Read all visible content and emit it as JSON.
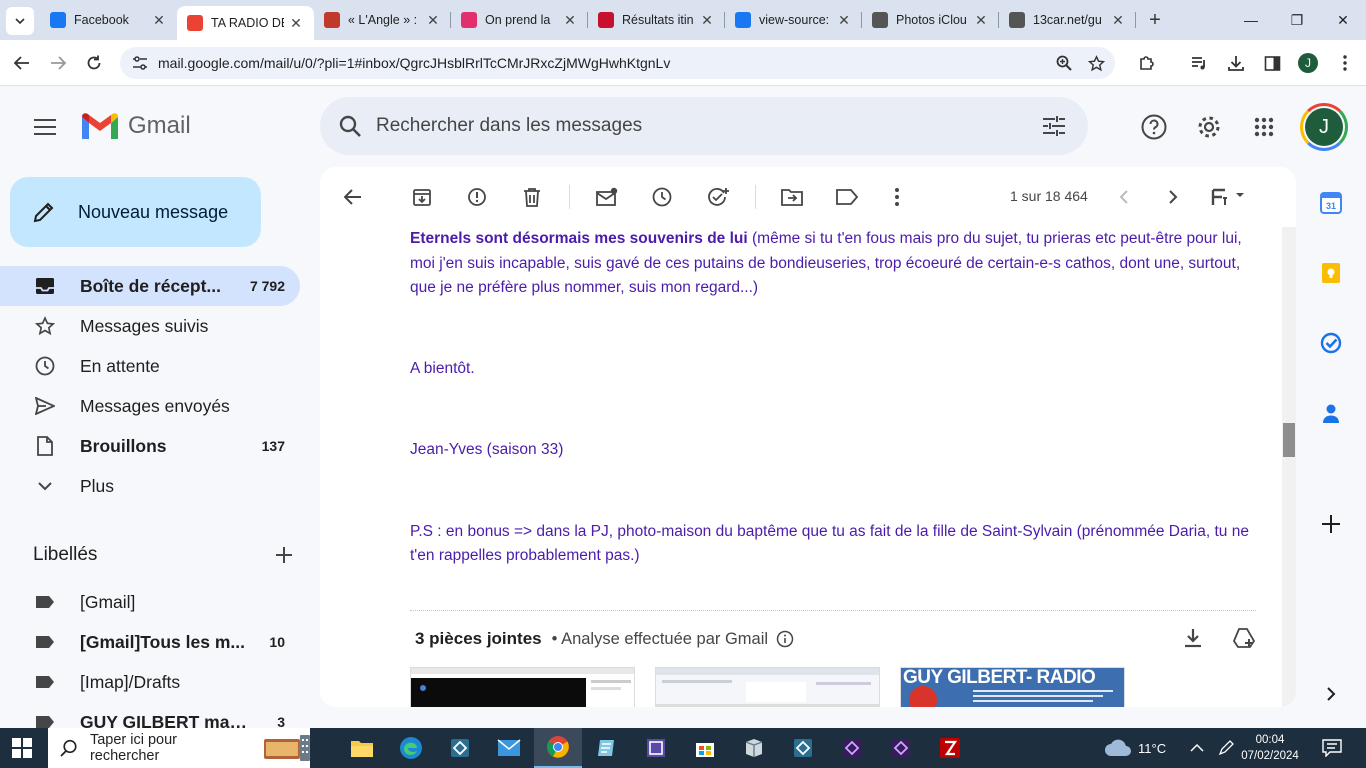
{
  "browser": {
    "tabs": [
      {
        "title": "Facebook",
        "favicon": "facebook-icon",
        "color": "#1877f2"
      },
      {
        "title": "TA RADIO DE",
        "favicon": "gmail-icon",
        "color": "#ea4335",
        "active": true
      },
      {
        "title": "« L'Angle » :",
        "favicon": "site-icon",
        "color": "#c0392b"
      },
      {
        "title": "On prend la",
        "favicon": "instagram-icon",
        "color": "#e1306c"
      },
      {
        "title": "Résultats itin",
        "favicon": "sncf-icon",
        "color": "#c8102e"
      },
      {
        "title": "view-source:",
        "favicon": "facebook-icon",
        "color": "#1877f2"
      },
      {
        "title": "Photos iClou",
        "favicon": "apple-icon",
        "color": "#555555"
      },
      {
        "title": "13car.net/gu",
        "favicon": "globe-icon",
        "color": "#555555"
      }
    ],
    "url": "mail.google.com/mail/u/0/?pli=1#inbox/QgrcJHsblRrlTcCMrJRxcZjMWgHwhKtgnLv",
    "profile_initial": "J"
  },
  "gmail": {
    "app_name": "Gmail",
    "search_placeholder": "Rechercher dans les messages",
    "account_initial": "J",
    "compose_label": "Nouveau message",
    "nav": [
      {
        "label": "Boîte de récept...",
        "count": "7 792",
        "icon": "inbox-icon",
        "active": true,
        "bold": true
      },
      {
        "label": "Messages suivis",
        "count": "",
        "icon": "star-icon"
      },
      {
        "label": "En attente",
        "count": "",
        "icon": "clock-icon"
      },
      {
        "label": "Messages envoyés",
        "count": "",
        "icon": "send-icon"
      },
      {
        "label": "Brouillons",
        "count": "137",
        "icon": "draft-icon",
        "bold": true
      },
      {
        "label": "Plus",
        "count": "",
        "icon": "chevron-down-icon"
      }
    ],
    "labels_title": "Libellés",
    "labels": [
      {
        "label": "[Gmail]",
        "count": ""
      },
      {
        "label": "[Gmail]Tous les m...",
        "count": "10",
        "bold": true
      },
      {
        "label": "[Imap]/Drafts",
        "count": ""
      },
      {
        "label": "GUY GILBERT mail...",
        "count": "3",
        "bold": true
      }
    ],
    "pager_text": "1 sur 18 464",
    "message": {
      "p1_bold": "Eternels sont désormais mes souvenirs de lui",
      "p1_rest": " (même si tu t'en fous mais pro du sujet, tu prieras etc peut-être pour lui, moi j'en suis incapable, suis gavé de ces putains de bondieuseries, trop écoeuré de certain-e-s cathos, dont une, surtout, que je ne préfère plus nommer, suis mon regard...)",
      "p2": "A bientôt.",
      "p3": "Jean-Yves (saison 33)",
      "p4": "P.S : en bonus => dans la PJ, photo-maison du baptême que tu as fait de la fille de Saint-Sylvain (prénommée Daria, tu ne t'en rappelles probablement pas.)"
    },
    "attachments": {
      "count_label": "3 pièces jointes",
      "scan_label": "• Analyse effectuée par Gmail",
      "third_thumb_text": "GUY GILBERT- RADIO"
    },
    "colors": {
      "message_text": "#4b1cab",
      "compose_bg": "#c2e7ff",
      "active_nav_bg": "#d3e3fd"
    }
  },
  "taskbar": {
    "search_placeholder": "Taper ici pour rechercher",
    "weather": "11°C",
    "time": "00:04",
    "date": "07/02/2024"
  }
}
